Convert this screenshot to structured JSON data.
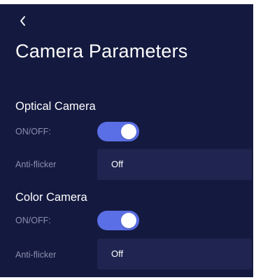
{
  "header": {
    "back_icon": "chevron-left-icon",
    "title": "Camera Parameters"
  },
  "sections": [
    {
      "title": "Optical Camera",
      "onoff_label": "ON/OFF:",
      "onoff_state": true,
      "antiflicker_label": "Anti-flicker",
      "antiflicker_value": "Off"
    },
    {
      "title": "Color Camera",
      "onoff_label": "ON/OFF:",
      "onoff_state": true,
      "antiflicker_label": "Anti-flicker",
      "antiflicker_value": "Off"
    }
  ],
  "colors": {
    "background": "#14193f",
    "field_background": "#1f2550",
    "toggle_on": "#5a6fe6",
    "label_muted": "#8a8fae",
    "text_primary": "#ffffff"
  }
}
